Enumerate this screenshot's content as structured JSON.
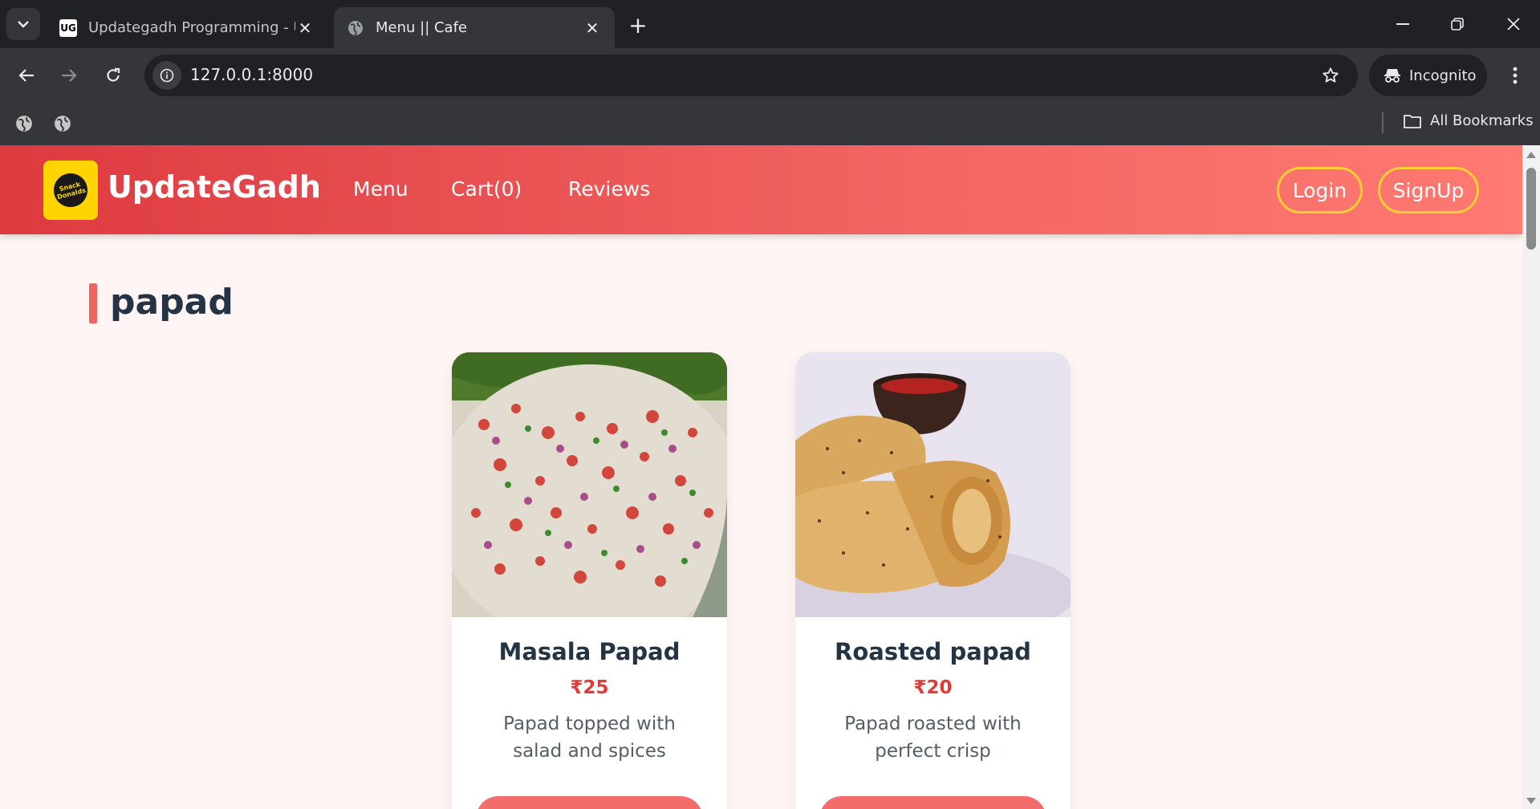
{
  "browser": {
    "tabs": [
      {
        "title": "Updategadh Programming - Up",
        "favicon": "UG"
      },
      {
        "title": "Menu || Cafe",
        "favicon": "globe-icon"
      }
    ],
    "url": "127.0.0.1:8000",
    "incognito_label": "Incognito",
    "bookmarks_label": "All Bookmarks"
  },
  "site": {
    "brand": "UpdateGadh",
    "logo_text": "Snack Donalds",
    "nav": {
      "menu": "Menu",
      "cart": "Cart(0)",
      "reviews": "Reviews"
    },
    "auth": {
      "login": "Login",
      "signup": "SignUp"
    },
    "colors": {
      "nav_start": "#dd3a40",
      "nav_end": "#ff7a72",
      "accent": "#f0645f",
      "price": "#e53935",
      "button_border": "#ffcf33",
      "page_bg": "#fff5f4"
    }
  },
  "section": {
    "title": "papad"
  },
  "items": [
    {
      "name": "Masala Papad",
      "price": "₹25",
      "description": "Papad topped with salad and spices"
    },
    {
      "name": "Roasted papad",
      "price": "₹20",
      "description": "Papad roasted with perfect crisp"
    }
  ]
}
